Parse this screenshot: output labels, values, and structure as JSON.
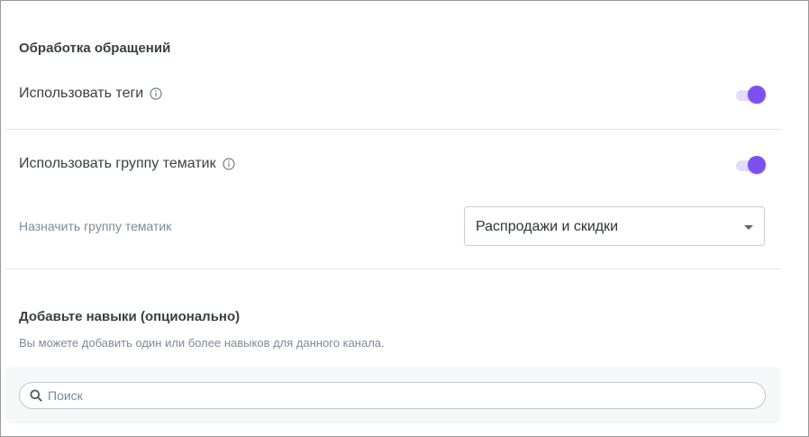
{
  "processing": {
    "title": "Обработка обращений",
    "use_tags_label": "Использовать теги",
    "use_tags_enabled": true,
    "use_topic_group_label": "Использовать группу тематик",
    "use_topic_group_enabled": true,
    "assign_topic_group_label": "Назначить группу тематик",
    "assign_topic_group_value": "Распродажи и скидки"
  },
  "skills": {
    "title": "Добавьте навыки (опционально)",
    "description": "Вы можете добавить один или более навыков для данного канала.",
    "search_placeholder": "Поиск"
  },
  "icons": {
    "info": "info-icon",
    "search": "search-icon",
    "dropdown": "chevron-down-icon"
  },
  "colors": {
    "accent": "#7e4ff0",
    "toggle_track": "#e3dcf9",
    "muted_text": "#7a8c97",
    "divider": "#e2e5e8"
  }
}
